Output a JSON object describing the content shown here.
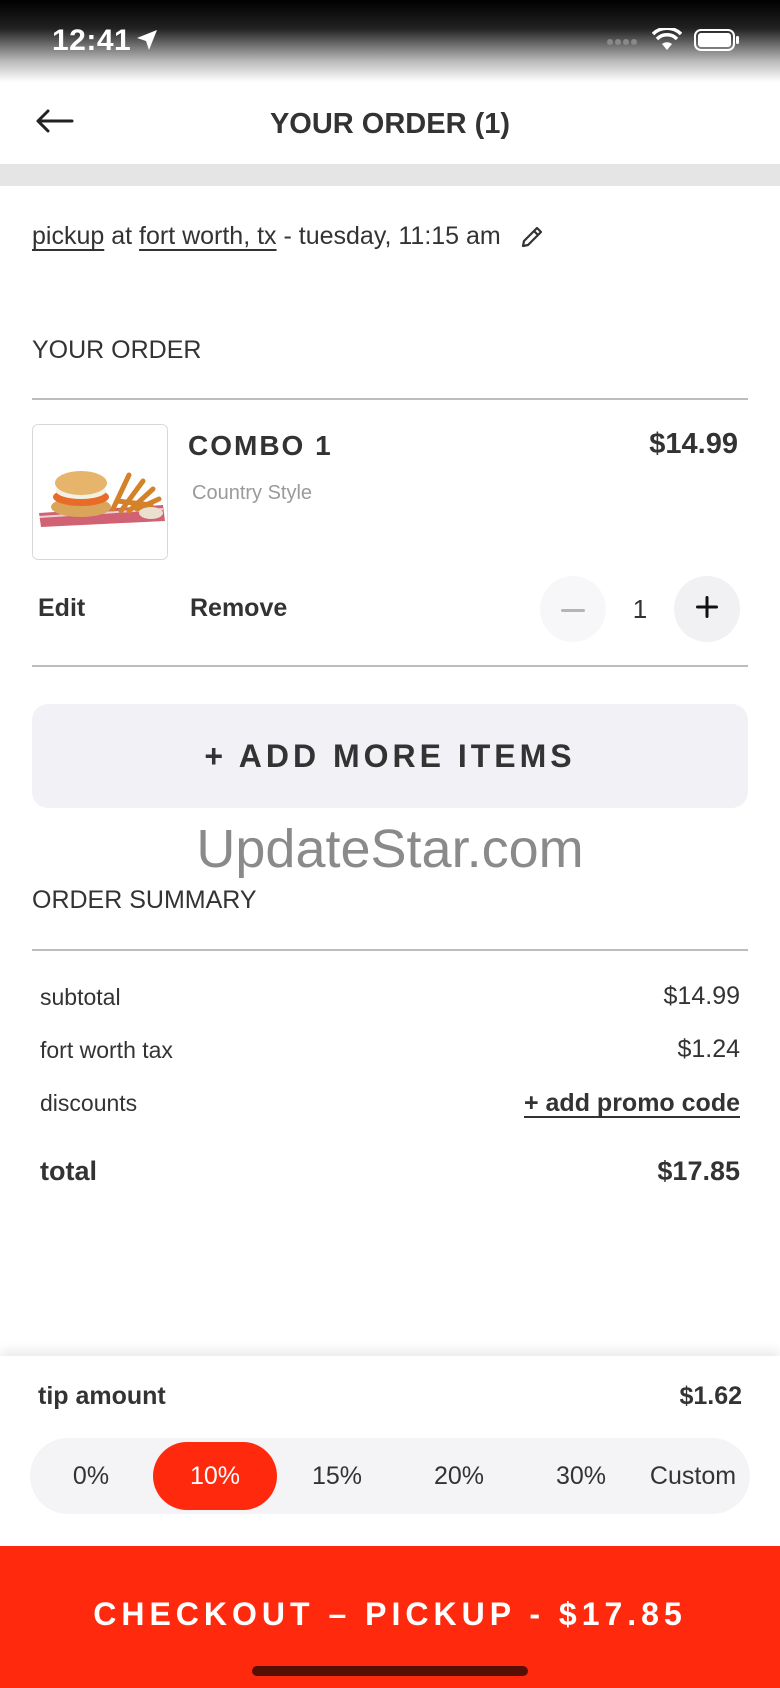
{
  "status_bar": {
    "time": "12:41"
  },
  "header": {
    "title": "YOUR ORDER (1)"
  },
  "pickup": {
    "mode": "pickup",
    "connector": " at ",
    "location": "fort worth, tx",
    "datetime": " - tuesday, 11:15 am"
  },
  "order": {
    "section_title": "YOUR ORDER",
    "items": [
      {
        "name": "COMBO 1",
        "style": "Country Style",
        "price": "$14.99",
        "quantity": "1",
        "edit_label": "Edit",
        "remove_label": "Remove"
      }
    ],
    "add_more_label": "+ ADD MORE ITEMS"
  },
  "watermark": "UpdateStar.com",
  "summary": {
    "section_title": "ORDER SUMMARY",
    "subtotal_label": "subtotal",
    "subtotal_value": "$14.99",
    "tax_label": "fort worth tax",
    "tax_value": "$1.24",
    "discounts_label": "discounts",
    "promo_label": "+ add promo code",
    "total_label": "total",
    "total_value": "$17.85"
  },
  "tip": {
    "label": "tip amount",
    "value": "$1.62",
    "options": [
      "0%",
      "10%",
      "15%",
      "20%",
      "30%",
      "Custom"
    ],
    "selected": "10%"
  },
  "checkout": {
    "label": "CHECKOUT – PICKUP - $17.85"
  },
  "colors": {
    "accent": "#ff2a0d",
    "text": "#333333",
    "muted": "#9a9a9a",
    "panel": "#f2f2f6"
  },
  "icons": [
    "location-arrow-icon",
    "signal-icon",
    "wifi-icon",
    "battery-icon",
    "back-arrow-icon",
    "pencil-icon",
    "minus-icon",
    "plus-icon"
  ]
}
